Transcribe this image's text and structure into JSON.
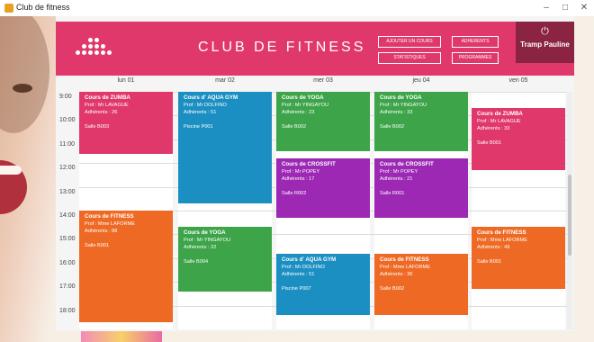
{
  "window": {
    "title": "Club de fitness",
    "minimize": "–",
    "maximize": "□",
    "close": "✕"
  },
  "header": {
    "title": "CLUB DE FITNESS",
    "logo_icon": "dots-logo-icon",
    "accent": "#e0386a",
    "buttons": [
      "AJOUTER UN COURS",
      "ADHERENTS",
      "STATISTIQUES",
      "PROGRAMMES"
    ]
  },
  "user": {
    "name": "Tramp Pauline",
    "icon": "power-icon",
    "power_glyph": "⏻",
    "color": "#8b2442"
  },
  "calendar": {
    "days": [
      "lun 01",
      "mar 02",
      "mer 03",
      "jeu 04",
      "ven 05"
    ],
    "times": [
      "9:00",
      "10:00",
      "11:00",
      "12:00",
      "13:00",
      "14:00",
      "15:00",
      "16:00",
      "17:00",
      "18:00"
    ],
    "events": [
      {
        "day": 0,
        "start": 9,
        "end": 11.6,
        "title": "Cours de ZUMBA",
        "prof": "Prof : Mr LAVAGUE",
        "adh": "Adhérents : 26",
        "salle": "Salle B003",
        "color": "#e0386a"
      },
      {
        "day": 0,
        "start": 14,
        "end": 18.7,
        "title": "Cours de FITNESS",
        "prof": "Prof : Mme LAFORME",
        "adh": "Adhérents : 88",
        "salle": "Salle B001",
        "color": "#ee6a24"
      },
      {
        "day": 1,
        "start": 9,
        "end": 13.7,
        "title": "Cours d' AQUA GYM",
        "prof": "Prof : Mr DOLFINO",
        "adh": "Adhérents : 51",
        "salle": "Piscine P001",
        "color": "#1c8fc2"
      },
      {
        "day": 1,
        "start": 14.7,
        "end": 17.4,
        "title": "Cours de YOGA",
        "prof": "Prof : Mr YINGAYOU",
        "adh": "Adhérents : 22",
        "salle": "Salle B004",
        "color": "#3da44a"
      },
      {
        "day": 2,
        "start": 9,
        "end": 11.5,
        "title": "Cours de YOGA",
        "prof": "Prof : Mr YINGAYOU",
        "adh": "Adhérents : 23",
        "salle": "Salle B002",
        "color": "#3da44a"
      },
      {
        "day": 2,
        "start": 11.8,
        "end": 14.3,
        "title": "Cours de CROSSFIT",
        "prof": "Prof : Mr POPEY",
        "adh": "Adhérents : 17",
        "salle": "Salle R002",
        "color": "#9c28b4"
      },
      {
        "day": 2,
        "start": 15.8,
        "end": 18.4,
        "title": "Cours d' AQUA GYM",
        "prof": "Prof : Mr DOLFINO",
        "adh": "Adhérents : 51",
        "salle": "Piscine P007",
        "color": "#1c8fc2"
      },
      {
        "day": 3,
        "start": 9,
        "end": 11.5,
        "title": "Cours de YOGA",
        "prof": "Prof : Mr YINGAYOU",
        "adh": "Adhérents : 33",
        "salle": "Salle B002",
        "color": "#3da44a"
      },
      {
        "day": 3,
        "start": 11.8,
        "end": 14.3,
        "title": "Cours de CROSSFIT",
        "prof": "Prof : Mr POPEY",
        "adh": "Adhérents : 21",
        "salle": "Salle R001",
        "color": "#9c28b4"
      },
      {
        "day": 3,
        "start": 15.8,
        "end": 18.4,
        "title": "Cours de FITNESS",
        "prof": "Prof : Mme LAFORME",
        "adh": "Adhérents : 36",
        "salle": "Salle B002",
        "color": "#ee6a24"
      },
      {
        "day": 4,
        "start": 9.7,
        "end": 12.3,
        "title": "Cours de ZUMBA",
        "prof": "Prof : Mr LAVAGUE",
        "adh": "Adhérents : 33",
        "salle": "Salle B001",
        "color": "#e0386a"
      },
      {
        "day": 4,
        "start": 14.7,
        "end": 17.3,
        "title": "Cours de FITNESS",
        "prof": "Prof : Mme LAFORME",
        "adh": "Adhérents : 49",
        "salle": "Salle B001",
        "color": "#ee6a24"
      }
    ]
  }
}
